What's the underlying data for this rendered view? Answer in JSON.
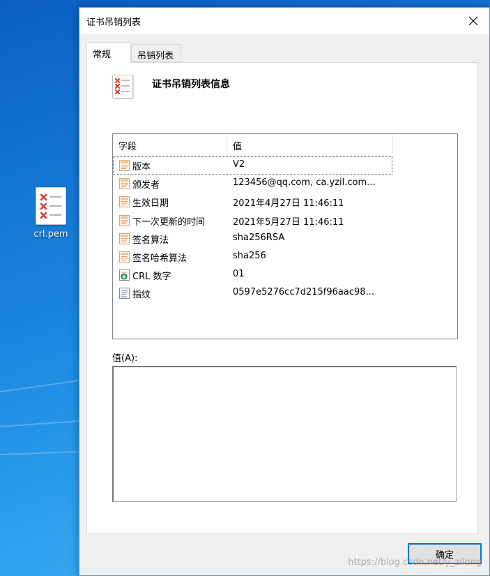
{
  "desktop": {
    "file_label": "crl.pem"
  },
  "window": {
    "title": "证书吊销列表",
    "tabs": [
      {
        "label": "常规",
        "active": true
      },
      {
        "label": "吊销列表",
        "active": false
      }
    ],
    "heading": "证书吊销列表信息",
    "list": {
      "columns": [
        "字段",
        "值"
      ],
      "rows": [
        {
          "field": "版本",
          "value": "V2",
          "icon": "document-field-icon"
        },
        {
          "field": "颁发者",
          "value": "123456@qq.com, ca.yzil.com...",
          "icon": "document-field-icon"
        },
        {
          "field": "生效日期",
          "value": "2021年4月27日 11:46:11",
          "icon": "document-field-icon"
        },
        {
          "field": "下一次更新的时间",
          "value": "2021年5月27日 11:46:11",
          "icon": "document-field-icon"
        },
        {
          "field": "签名算法",
          "value": "sha256RSA",
          "icon": "document-field-icon"
        },
        {
          "field": "签名哈希算法",
          "value": "sha256",
          "icon": "document-field-icon"
        },
        {
          "field": "CRL 数字",
          "value": "01",
          "icon": "crl-number-icon"
        },
        {
          "field": "指纹",
          "value": "0597e5276cc7d215f96aac98...",
          "icon": "fingerprint-field-icon"
        }
      ]
    },
    "value_label": "值(A):",
    "ok_label": "确定"
  },
  "watermark": "https://blog.csdn.net/y_zilong",
  "colors": {
    "desktop_blue": "#1a86e0",
    "focus_blue": "#0078d7",
    "field_icon_orange": "#e8a25a",
    "cross_red": "#d83b2b"
  }
}
